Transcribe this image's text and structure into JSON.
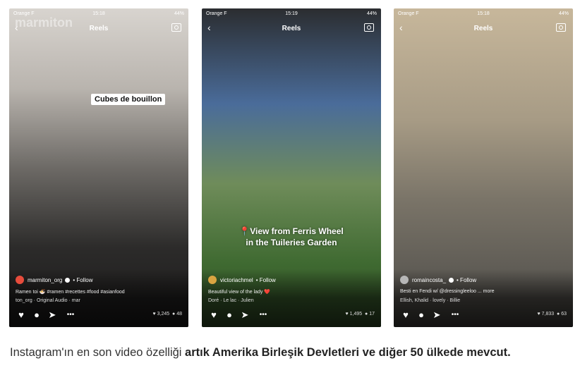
{
  "phones": [
    {
      "status": {
        "carrier": "Orange F",
        "time": "15:18",
        "battery": "44%"
      },
      "title": "Reels",
      "watermark": "marmiton",
      "tag": "Cubes de bouillon",
      "username": "marmiton_org",
      "follow": "• Follow",
      "caption": "Ramen toi 🍜 #ramen #recettes #food #asianfood",
      "audio": "ton_org · Original Audio · mar",
      "likes": "3,245",
      "comments": "48"
    },
    {
      "status": {
        "carrier": "Orange F",
        "time": "15:19",
        "battery": "44%"
      },
      "title": "Reels",
      "overlay_line1": "View from Ferris Wheel",
      "overlay_line2": "in the Tuileries Garden",
      "username": "victoriachmel",
      "follow": "• Follow",
      "caption": "Beautiful view of the lady ❤️",
      "audio": "Doré · Le lac · Julien",
      "likes": "1,495",
      "comments": "17"
    },
    {
      "status": {
        "carrier": "Orange F",
        "time": "15:18",
        "battery": "44%"
      },
      "title": "Reels",
      "username": "romaincosta_",
      "follow": "• Follow",
      "caption": "Besti en Fendi w/ @dressingleeloo ... more",
      "audio": "Ellish, Khalid · lovely · Billie",
      "likes": "7,833",
      "comments": "63"
    }
  ],
  "article_text": {
    "normal": "Instagram'ın en son video özelliği ",
    "bold": "artık Amerika Birleşik Devletleri ve diğer 50 ülkede mevcut."
  }
}
